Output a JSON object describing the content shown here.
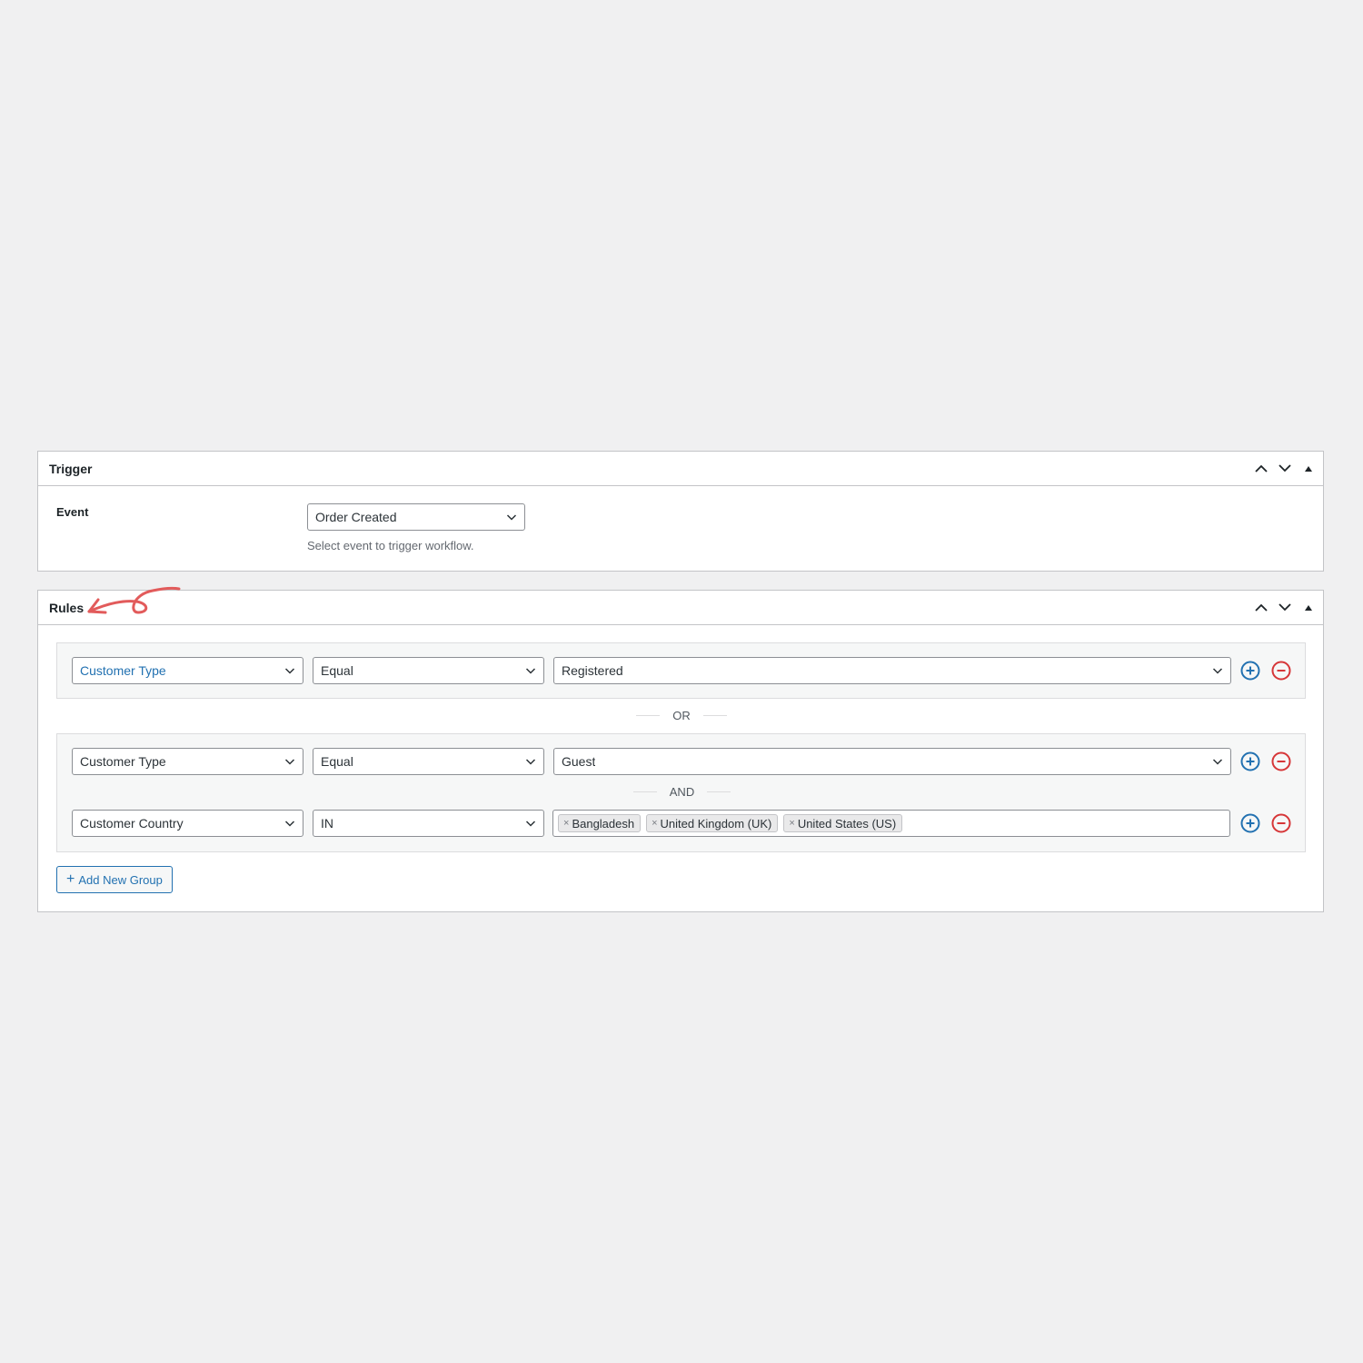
{
  "trigger": {
    "title": "Trigger",
    "event_label": "Event",
    "event_value": "Order Created",
    "event_description": "Select event to trigger workflow."
  },
  "rules": {
    "title": "Rules",
    "separator_or": "OR",
    "separator_and": "AND",
    "groups": [
      {
        "rules": [
          {
            "field": "Customer Type",
            "operator": "Equal",
            "value": "Registered"
          }
        ]
      },
      {
        "rules": [
          {
            "field": "Customer Type",
            "operator": "Equal",
            "value": "Guest"
          },
          {
            "field": "Customer Country",
            "operator": "IN",
            "tags": [
              "Bangladesh",
              "United Kingdom (UK)",
              "United States (US)"
            ]
          }
        ]
      }
    ],
    "add_group_label": "Add New Group"
  },
  "colors": {
    "accent": "#2271b1",
    "danger": "#d63638",
    "annotation_arrow": "#e25b5b"
  },
  "icons": {
    "move_up": "chevron-up-icon",
    "move_down": "chevron-down-icon",
    "toggle": "triangle-up-icon",
    "add_rule": "plus-circle-icon",
    "remove_rule": "minus-circle-icon"
  }
}
